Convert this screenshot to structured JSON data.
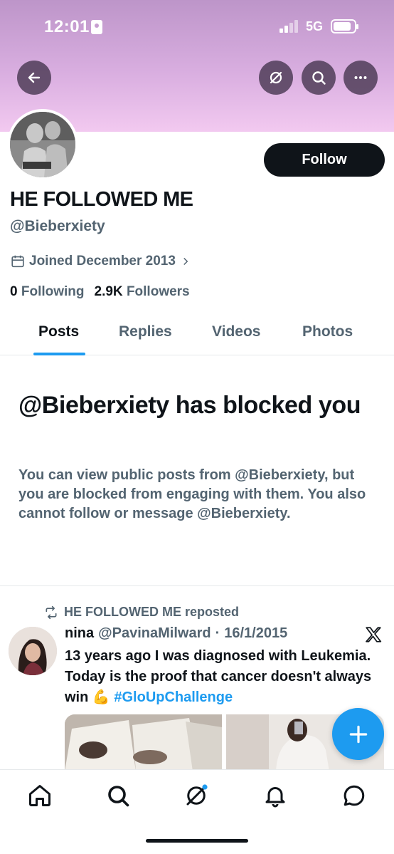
{
  "status_bar": {
    "time": "12:01",
    "network": "5G"
  },
  "header": {
    "back_icon": "arrow-left-icon",
    "grok_icon": "slash-circle-icon",
    "search_icon": "search-icon",
    "more_icon": "more-horizontal-icon"
  },
  "profile": {
    "follow_label": "Follow",
    "display_name": "HE FOLLOWED ME",
    "handle": "@Bieberxiety",
    "joined": "Joined December 2013",
    "following_count": "0",
    "following_label": "Following",
    "followers_count": "2.9K",
    "followers_label": "Followers"
  },
  "tabs": [
    {
      "label": "Posts",
      "active": true
    },
    {
      "label": "Replies",
      "active": false
    },
    {
      "label": "Videos",
      "active": false
    },
    {
      "label": "Photos",
      "active": false
    }
  ],
  "blocked": {
    "title": "@Bieberxiety has blocked you",
    "description": "You can view public posts from @Bieberxiety, but you are blocked from engaging with them. You also cannot follow or message @Bieberxiety."
  },
  "post": {
    "repost_label": "HE FOLLOWED ME reposted",
    "author_name": "nina",
    "author_handle": "@PavinaMilward",
    "separator": "·",
    "date": "16/1/2015",
    "text_main": "13 years ago I was diagnosed with Leukemia. Today is the proof that cancer doesn't always win",
    "emoji": "💪",
    "hashtag": "#GloUpChallenge"
  },
  "bottom_nav": [
    "home-icon",
    "search-icon",
    "grok-icon",
    "notifications-icon",
    "messages-icon"
  ],
  "colors": {
    "accent": "#1d9bf0",
    "text": "#0f1419",
    "secondary_text": "#536471",
    "banner": "#d9aee0"
  }
}
